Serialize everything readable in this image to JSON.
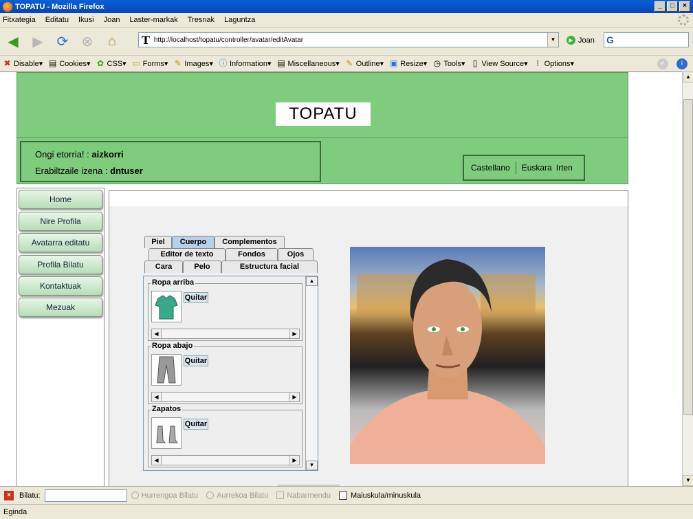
{
  "window": {
    "title": "TOPATU - Mozilla Firefox",
    "min": "_",
    "max": "□",
    "close": "×"
  },
  "menu": [
    "Fitxategia",
    "Editatu",
    "Ikusi",
    "Joan",
    "Laster-markak",
    "Tresnak",
    "Laguntza"
  ],
  "navbar": {
    "url": "http://localhost/topatu/controller/avatar/editAvatar",
    "go_label": "Joan",
    "search_value": "G"
  },
  "devbar": [
    "Disable",
    "Cookies",
    "CSS",
    "Forms",
    "Images",
    "Information",
    "Miscellaneous",
    "Outline",
    "Resize",
    "Tools",
    "View Source",
    "Options"
  ],
  "page": {
    "logo": "TOPATU",
    "welcome_label": "Ongi etorria! :",
    "welcome_user": "aizkorri",
    "username_label": "Erabiltzaile izena :",
    "username_value": "dntuser",
    "lang_castellano": "Castellano",
    "lang_euskara": "Euskara",
    "logout": "Irten"
  },
  "leftnav": [
    "Home",
    "Nire Profila",
    "Avatarra editatu",
    "Profila Bilatu",
    "Kontaktuak",
    "Mezuak"
  ],
  "tabs": {
    "row1": [
      "Piel",
      "Cuerpo",
      "Complementos"
    ],
    "row2": [
      "Editor de texto",
      "Fondos",
      "Ojos"
    ],
    "row3": [
      "Cara",
      "Pelo",
      "Estructura facial"
    ],
    "active": "Cuerpo"
  },
  "groups": [
    {
      "title": "Ropa arriba",
      "button": "Quitar",
      "icon": "shirt-icon"
    },
    {
      "title": "Ropa abajo",
      "button": "Quitar",
      "icon": "pants-icon"
    },
    {
      "title": "Zapatos",
      "button": "Quitar",
      "icon": "shoes-icon"
    }
  ],
  "findbar": {
    "label": "Bilatu:",
    "next": "Hurrengoa Bilatu",
    "prev": "Aurrekoa Bilatu",
    "highlight": "Nabarmendu",
    "match_case": "Maiuskula/minuskula"
  },
  "status": "Eginda",
  "colors": {
    "header_green": "#7fcc7f",
    "active_tab": "#b8cfe8"
  }
}
